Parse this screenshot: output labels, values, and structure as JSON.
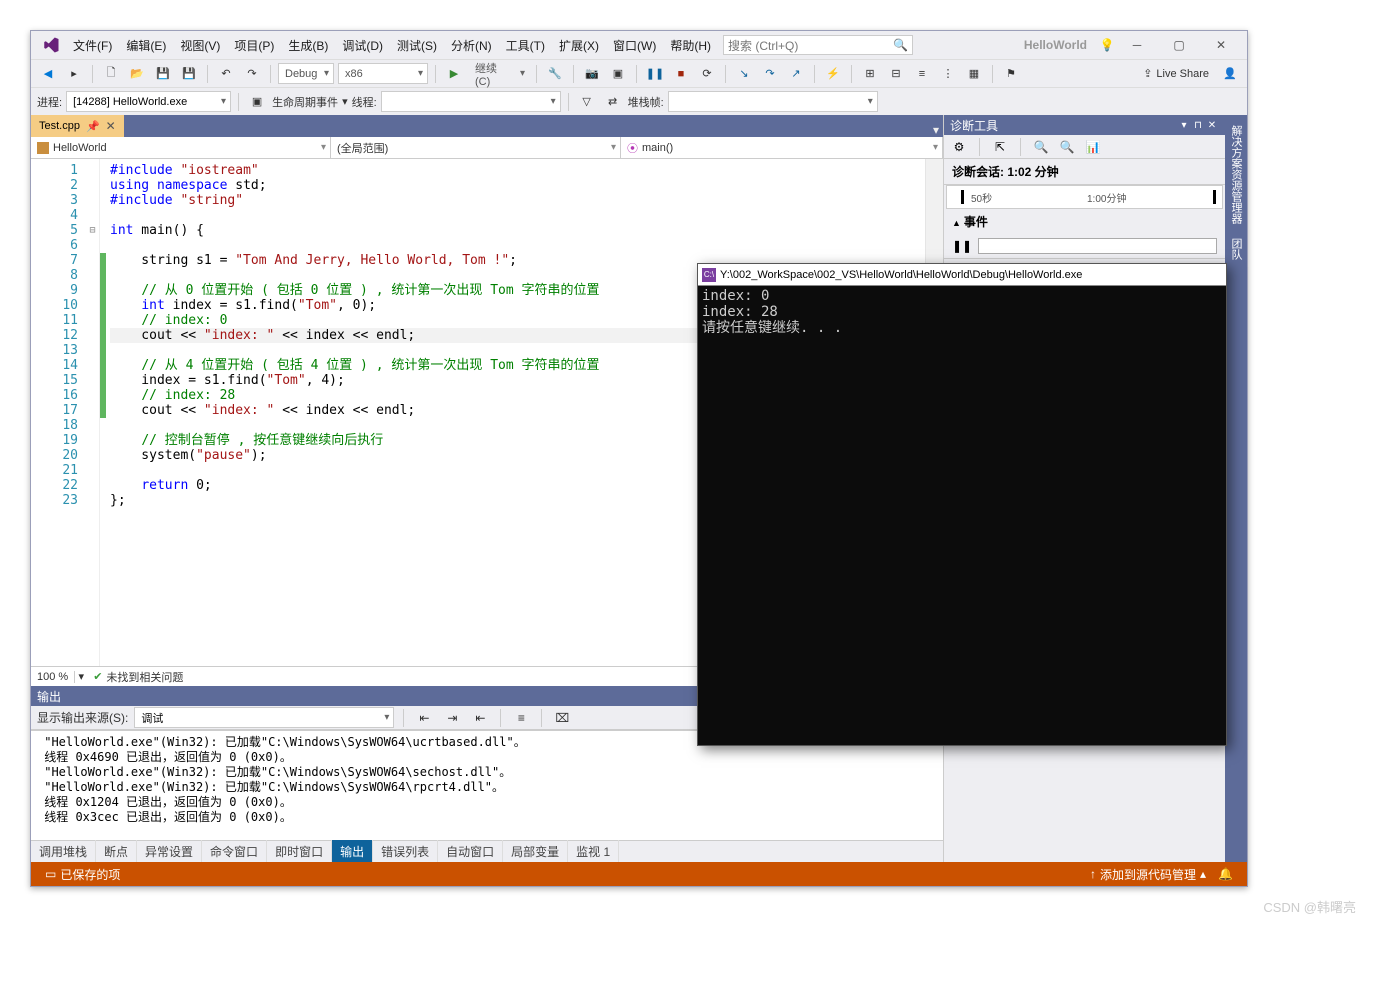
{
  "menu": {
    "file": "文件(F)",
    "edit": "编辑(E)",
    "view": "视图(V)",
    "project": "项目(P)",
    "build": "生成(B)",
    "debug": "调试(D)",
    "test": "测试(S)",
    "analyze": "分析(N)",
    "tools": "工具(T)",
    "extensions": "扩展(X)",
    "window": "窗口(W)",
    "help": "帮助(H)"
  },
  "search_placeholder": "搜索 (Ctrl+Q)",
  "solution_name": "HelloWorld",
  "toolbar1": {
    "config": "Debug",
    "platform": "x86",
    "continue": "继续(C)"
  },
  "live_share": "Live Share",
  "toolbar2": {
    "process_label": "进程:",
    "process_value": "[14288] HelloWorld.exe",
    "lifecycle": "生命周期事件",
    "thread_label": "线程:",
    "stack_label": "堆栈帧:"
  },
  "tab_name": "Test.cpp",
  "nav": {
    "scope": "HelloWorld",
    "scope2": "(全局范围)",
    "func": "main()"
  },
  "code_lines": [
    {
      "n": 1,
      "html": "<span class='kw'>#include</span> <span class='str'>\"iostream\"</span>"
    },
    {
      "n": 2,
      "html": "<span class='kw'>using</span> <span class='kw'>namespace</span> std;"
    },
    {
      "n": 3,
      "html": "<span class='kw'>#include</span> <span class='str'>\"string\"</span>"
    },
    {
      "n": 4,
      "html": ""
    },
    {
      "n": 5,
      "html": "<span class='kw'>int</span> main() {",
      "fold": "⊟"
    },
    {
      "n": 6,
      "html": ""
    },
    {
      "n": 7,
      "html": "    string s1 = <span class='str'>\"Tom And Jerry, Hello World, Tom !\"</span>;",
      "mark": "green"
    },
    {
      "n": 8,
      "html": "",
      "mark": "green"
    },
    {
      "n": 9,
      "html": "    <span class='cm'>// 从 0 位置开始 ( 包括 0 位置 ) , 统计第一次出现 Tom 字符串的位置</span>",
      "mark": "green"
    },
    {
      "n": 10,
      "html": "    <span class='kw'>int</span> index = s1.find(<span class='str'>\"Tom\"</span>, 0);",
      "mark": "green"
    },
    {
      "n": 11,
      "html": "    <span class='cm'>// index: 0</span>",
      "mark": "green"
    },
    {
      "n": 12,
      "html": "    cout &lt;&lt; <span class='str'>\"index: \"</span> &lt;&lt; index &lt;&lt; endl;",
      "mark": "green",
      "cur": true
    },
    {
      "n": 13,
      "html": "",
      "mark": "green"
    },
    {
      "n": 14,
      "html": "    <span class='cm'>// 从 4 位置开始 ( 包括 4 位置 ) , 统计第一次出现 Tom 字符串的位置</span>",
      "mark": "green"
    },
    {
      "n": 15,
      "html": "    index = s1.find(<span class='str'>\"Tom\"</span>, 4);",
      "mark": "green"
    },
    {
      "n": 16,
      "html": "    <span class='cm'>// index: 28</span>",
      "mark": "green"
    },
    {
      "n": 17,
      "html": "    cout &lt;&lt; <span class='str'>\"index: \"</span> &lt;&lt; index &lt;&lt; endl;",
      "mark": "green"
    },
    {
      "n": 18,
      "html": ""
    },
    {
      "n": 19,
      "html": "    <span class='cm'>// 控制台暂停 , 按任意键继续向后执行</span>"
    },
    {
      "n": 20,
      "html": "    system(<span class='str'>\"pause\"</span>);"
    },
    {
      "n": 21,
      "html": ""
    },
    {
      "n": 22,
      "html": "    <span class='kw'>return</span> 0;"
    },
    {
      "n": 23,
      "html": "};"
    }
  ],
  "zoom": "100 %",
  "no_issues": "未找到相关问题",
  "output": {
    "title": "输出",
    "source_label": "显示输出来源(S):",
    "source_value": "调试",
    "lines": [
      " \"HelloWorld.exe\"(Win32): 已加载\"C:\\Windows\\SysWOW64\\ucrtbased.dll\"。",
      " 线程 0x4690 已退出，返回值为 0 (0x0)。",
      " \"HelloWorld.exe\"(Win32): 已加载\"C:\\Windows\\SysWOW64\\sechost.dll\"。",
      " \"HelloWorld.exe\"(Win32): 已加载\"C:\\Windows\\SysWOW64\\rpcrt4.dll\"。",
      " 线程 0x1204 已退出，返回值为 0 (0x0)。",
      " 线程 0x3cec 已退出，返回值为 0 (0x0)。"
    ]
  },
  "out_tabs": [
    "调用堆栈",
    "断点",
    "异常设置",
    "命令窗口",
    "即时窗口",
    "输出",
    "错误列表",
    "自动窗口",
    "局部变量",
    "监视 1"
  ],
  "out_tab_active": "输出",
  "diag": {
    "title": "诊断工具",
    "session": "诊断会话: 1:02 分钟",
    "t1": "50秒",
    "t2": "1:00分钟",
    "events": "事件"
  },
  "sidetabs": [
    "解决方案资源管理器",
    "团队"
  ],
  "status": {
    "saved": "已保存的项",
    "scm": "添加到源代码管理"
  },
  "console": {
    "title": "Y:\\002_WorkSpace\\002_VS\\HelloWorld\\HelloWorld\\Debug\\HelloWorld.exe",
    "lines": [
      "index: 0",
      "index: 28",
      "请按任意键继续. . ."
    ]
  },
  "watermark": "CSDN @韩曙亮"
}
